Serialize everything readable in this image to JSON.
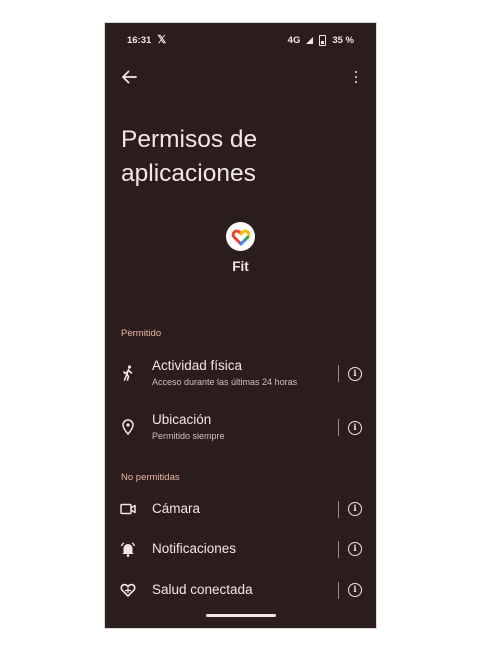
{
  "status_bar": {
    "time": "16:31",
    "x_glyph": "𝕏",
    "network": "4G",
    "battery": "35 %"
  },
  "page_title": "Permisos de aplicaciones",
  "app": {
    "name": "Fit",
    "icon": "google-fit-heart-icon"
  },
  "sections": [
    {
      "header": "Permitido"
    },
    {
      "header": "No permitidas"
    }
  ],
  "permissions": [
    {
      "title": "Actividad física",
      "subtitle": "Acceso durante las últimas 24 horas",
      "icon": "walking-person-icon"
    },
    {
      "title": "Ubicación",
      "subtitle": "Permitido siempre",
      "icon": "location-pin-icon"
    },
    {
      "title": "Cámara",
      "icon": "camera-icon"
    },
    {
      "title": "Notificaciones",
      "icon": "bell-icon"
    },
    {
      "title": "Salud conectada",
      "icon": "health-connect-icon"
    }
  ],
  "colors": {
    "background": "#2a1d1b",
    "text": "#f3e7e4",
    "section_header": "#f2b3a6",
    "subtitle": "#cfc1bd"
  }
}
